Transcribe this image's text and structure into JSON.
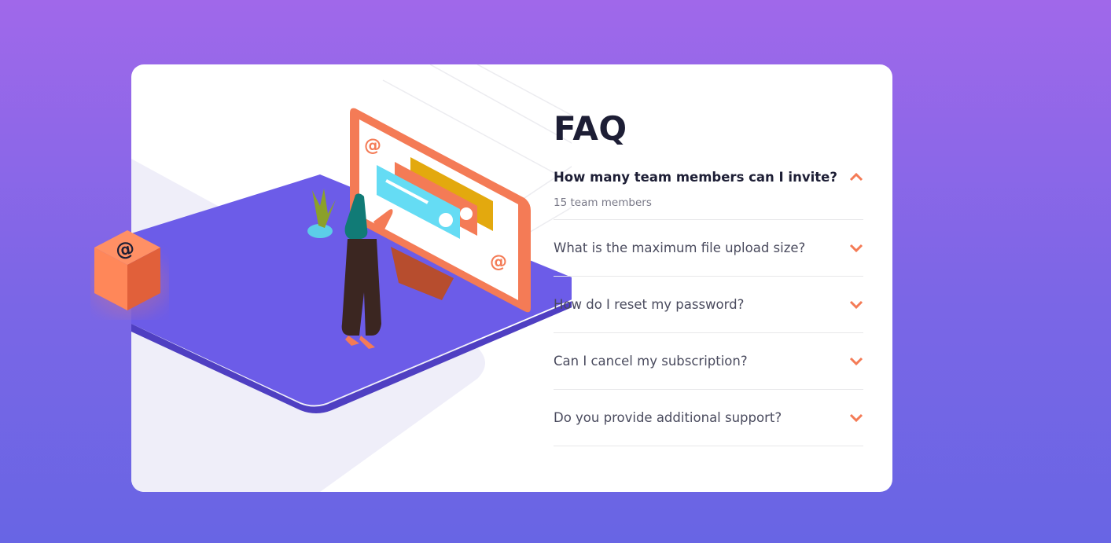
{
  "colors": {
    "bg_top": "#a068ea",
    "bg_bottom": "#6865e4",
    "accent": "#f47b56",
    "title": "#1d1e35",
    "text": "#4a4b5e",
    "answer": "#787887",
    "divider": "#e7e7e9"
  },
  "faq": {
    "title": "FAQ",
    "items": [
      {
        "question": "How many team members can I invite?",
        "answer": "15 team members",
        "expanded": true,
        "icon": "chevron-up-icon"
      },
      {
        "question": "What is the maximum file upload size?",
        "expanded": false,
        "icon": "chevron-down-icon"
      },
      {
        "question": "How do I reset my password?",
        "expanded": false,
        "icon": "chevron-down-icon"
      },
      {
        "question": "Can I cancel my subscription?",
        "expanded": false,
        "icon": "chevron-down-icon"
      },
      {
        "question": "Do you provide additional support?",
        "expanded": false,
        "icon": "chevron-down-icon"
      }
    ]
  },
  "illustration": {
    "name": "woman-online-illustration",
    "screen_symbol": "@"
  }
}
